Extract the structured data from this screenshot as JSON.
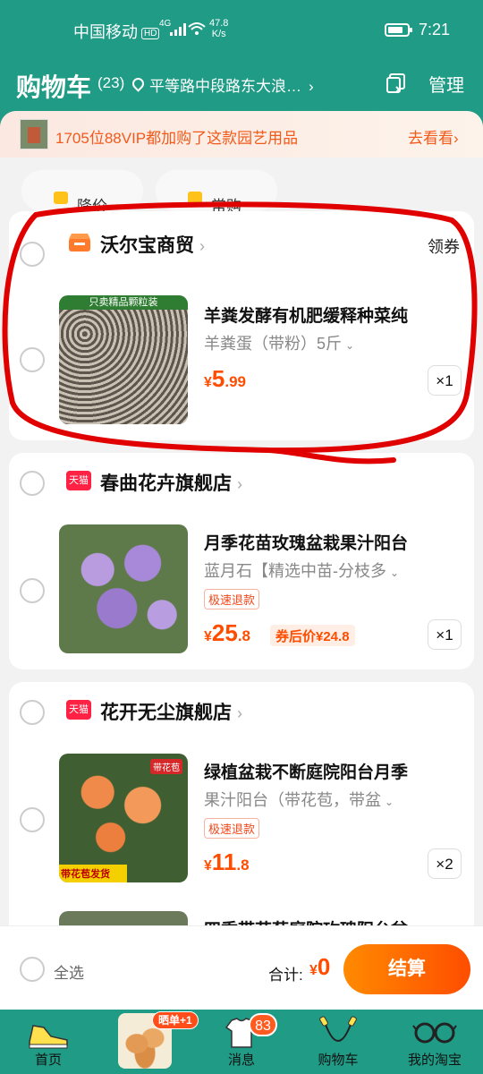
{
  "status_bar": {
    "carrier": "中国移动",
    "hd": "HD",
    "network": "4G",
    "speed_value": "47.8",
    "speed_unit": "K/s",
    "time": "7:21"
  },
  "header": {
    "title": "购物车",
    "count": "(23)",
    "location": "平等路中段路东大浪…",
    "manage_label": "管理"
  },
  "banner": {
    "text": "1705位88VIP都加购了这款园艺用品",
    "action": "去看看"
  },
  "filters": [
    "降价",
    "常购"
  ],
  "stores": [
    {
      "name": "沃尔宝商贸",
      "coupon": "领券",
      "product": {
        "name": "羊粪发酵有机肥缓释种菜纯",
        "sku": "羊粪蛋（带粉）5斤",
        "image_caption": "只卖精品颗粒装",
        "price_symbol": "¥",
        "price_int": "5",
        "price_dec": ".99",
        "qty": "×1"
      }
    },
    {
      "name": "春曲花卉旗舰店",
      "badge": "天猫",
      "product": {
        "name": "月季花苗玫瑰盆栽果汁阳台",
        "sku": "蓝月石【精选中苗-分枝多",
        "tag": "极速退款",
        "price_symbol": "¥",
        "price_int": "25",
        "price_dec": ".8",
        "after_coupon": "券后价¥24.8",
        "qty": "×1"
      }
    },
    {
      "name": "花开无尘旗舰店",
      "badge": "天猫",
      "product": {
        "name": "绿植盆栽不断庭院阳台月季",
        "sku": "果汁阳台（带花苞，带盆",
        "tag": "极速退款",
        "image_caption": "带花苞发货",
        "image_label": "带花苞",
        "price_symbol": "¥",
        "price_int": "11",
        "price_dec": ".8",
        "qty": "×2"
      }
    }
  ],
  "partial_product_name": "四季带花苞庭院玫瑰阳台盆",
  "bottom": {
    "select_all": "全选",
    "total_label": "合计:",
    "total_symbol": "¥",
    "total_value": "0",
    "checkout": "结算"
  },
  "tabbar": [
    {
      "label": "首页",
      "icon": "sneaker-icon"
    },
    {
      "label": "",
      "icon": "eggs-icon",
      "tag": "晒单+1"
    },
    {
      "label": "消息",
      "icon": "shirt-icon",
      "badge": "83"
    },
    {
      "label": "购物车",
      "icon": "jump-rope-icon"
    },
    {
      "label": "我的淘宝",
      "icon": "glasses-icon"
    }
  ],
  "colors": {
    "brand": "#1f9b86",
    "price": "#ff4d00",
    "checkout_from": "#ff8a00",
    "checkout_to": "#ff4d00"
  }
}
